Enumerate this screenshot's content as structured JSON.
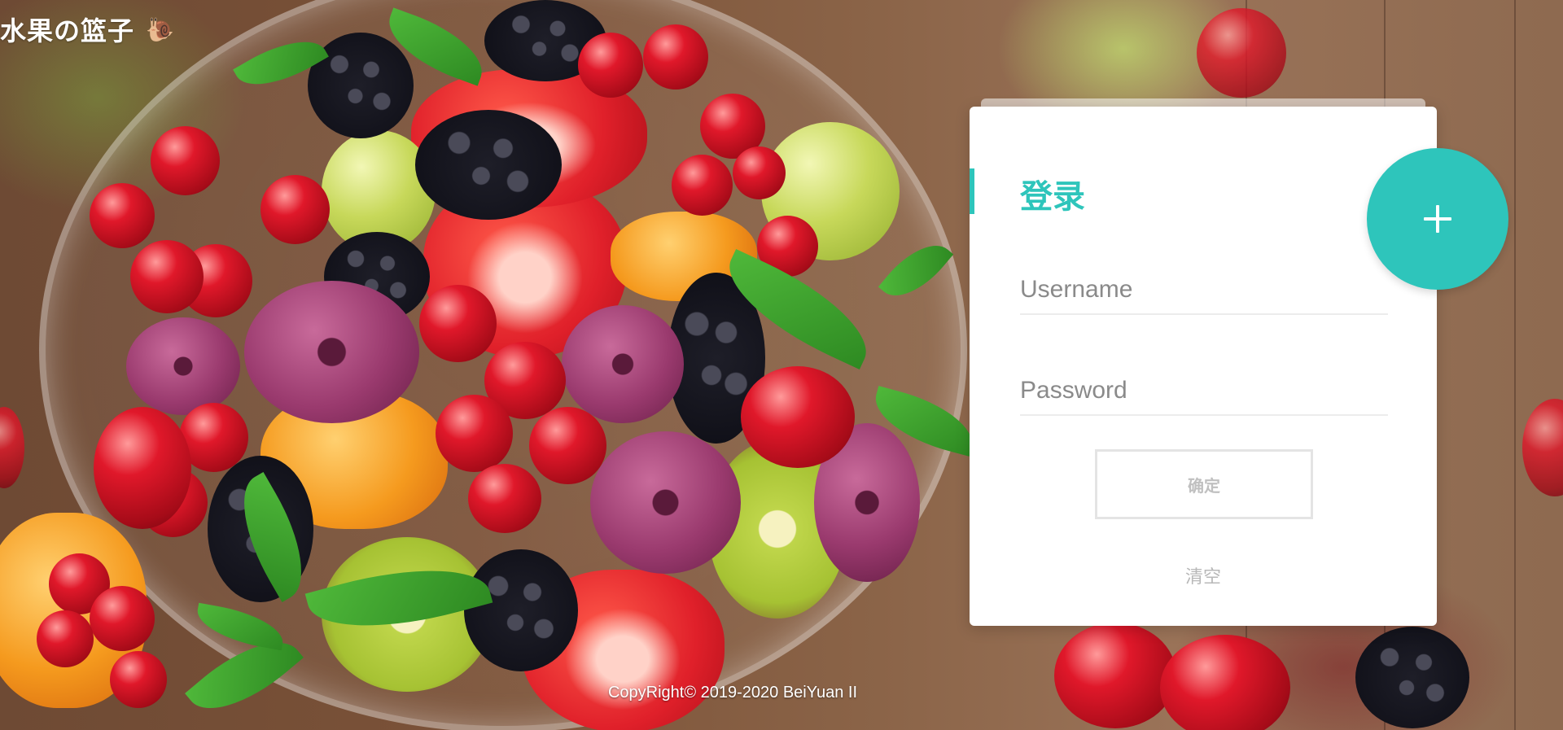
{
  "logo": {
    "text": "水果の篮子",
    "icon": "snail-icon"
  },
  "login": {
    "title": "登录",
    "username_placeholder": "Username",
    "password_placeholder": "Password",
    "username_value": "",
    "password_value": "",
    "confirm_label": "确定",
    "clear_label": "清空",
    "add_icon": "plus-icon"
  },
  "footer": {
    "copyright": "CopyRight© 2019-2020 BeiYuan II"
  },
  "colors": {
    "accent": "#2ec5bb",
    "card_bg": "#ffffff",
    "muted_text": "#b8b8b8"
  }
}
